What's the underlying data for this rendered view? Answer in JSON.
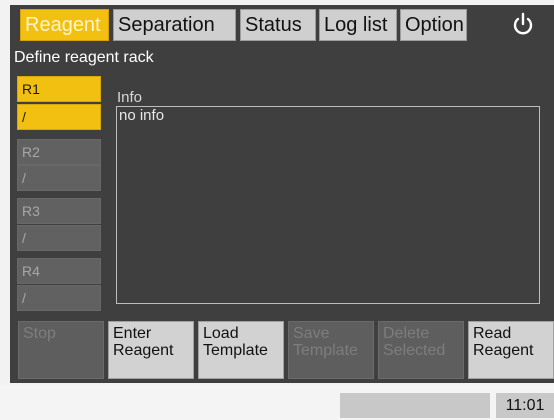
{
  "tabs": [
    {
      "label": "Reagent"
    },
    {
      "label": "Separation"
    },
    {
      "label": "Status"
    },
    {
      "label": "Log list"
    },
    {
      "label": "Option"
    }
  ],
  "header": {
    "power_icon": "power-icon"
  },
  "section": {
    "title": "Define reagent rack"
  },
  "rack": {
    "items": [
      {
        "label": "R1",
        "value": "/",
        "selected": true
      },
      {
        "label": "R2",
        "value": "/",
        "selected": false
      },
      {
        "label": "R3",
        "value": "/",
        "selected": false
      },
      {
        "label": "R4",
        "value": "/",
        "selected": false
      }
    ]
  },
  "info": {
    "label": "Info",
    "text": "no info"
  },
  "buttons": [
    {
      "label": "Stop",
      "enabled": false
    },
    {
      "label": "Enter\nReagent",
      "enabled": true
    },
    {
      "label": "Load\nTemplate",
      "enabled": true
    },
    {
      "label": "Save\nTemplate",
      "enabled": false
    },
    {
      "label": "Delete\nSelected",
      "enabled": false
    },
    {
      "label": "Read\nReagent",
      "enabled": true
    }
  ],
  "status": {
    "clock": "11:01"
  },
  "colors": {
    "accent": "#f2c010",
    "panel": "#3f3f3f",
    "button": "#d2d2d2",
    "disabled": "#5e5e5e"
  }
}
